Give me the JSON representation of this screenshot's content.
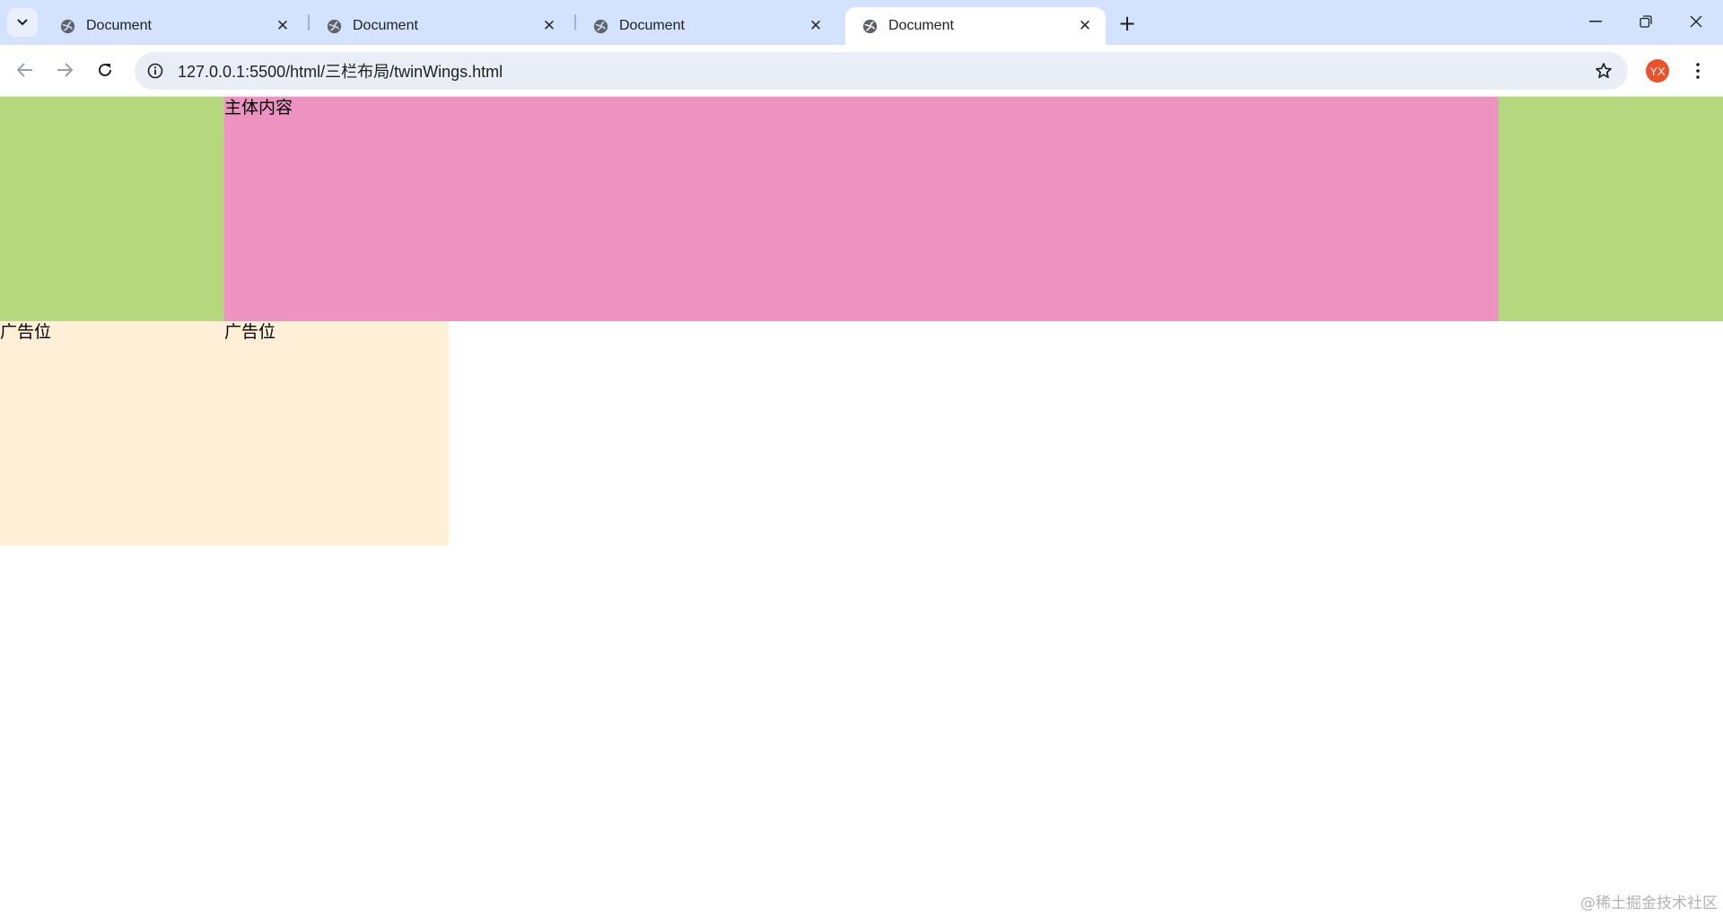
{
  "browser": {
    "tabs": [
      {
        "title": "Document",
        "active": false
      },
      {
        "title": "Document",
        "active": false
      },
      {
        "title": "Document",
        "active": false
      },
      {
        "title": "Document",
        "active": true
      }
    ],
    "url": "127.0.0.1:5500/html/三栏布局/twinWings.html",
    "profile_initials": "YX",
    "icons": {
      "tab_search": "chevron-down-icon",
      "favicon": "globe-icon",
      "close": "close-icon",
      "new_tab": "plus-icon",
      "back": "arrow-left-icon",
      "forward": "arrow-right-icon",
      "reload": "reload-icon",
      "site_info": "info-icon",
      "bookmark": "star-icon",
      "menu": "kebab-menu-icon",
      "minimize": "minimize-icon",
      "restore": "restore-icon",
      "window_close": "close-icon"
    }
  },
  "page": {
    "main_content": "主体内容",
    "ad_left": "广告位",
    "ad_right": "广告位",
    "colors": {
      "side_columns": "#b5d77e",
      "main_column": "#ee92c1",
      "ad_blocks": "#ffefd6"
    }
  },
  "watermark": "@稀土掘金技术社区"
}
